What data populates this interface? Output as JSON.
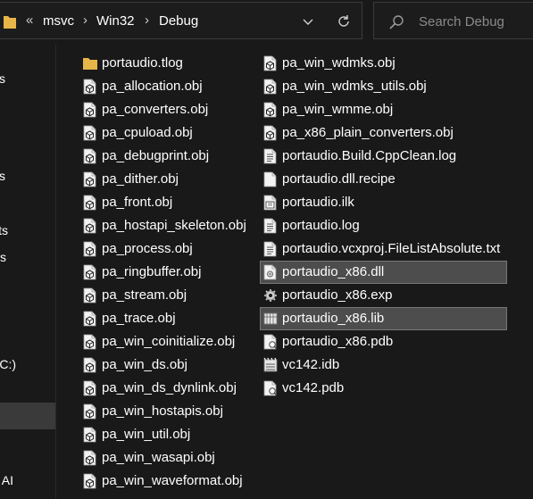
{
  "address_bar": {
    "overflow_label": "«",
    "breadcrumbs": [
      "msvc",
      "Win32",
      "Debug"
    ],
    "separator": "›",
    "dropdown_icon": "chevron-down-icon",
    "refresh_icon": "refresh-icon"
  },
  "search": {
    "placeholder": "Search Debug",
    "icon": "search-icon"
  },
  "nav_pane": {
    "items": [
      "s",
      "s",
      "ts",
      "s",
      "(C:)",
      "AI"
    ],
    "selected_index": 5
  },
  "colors": {
    "background": "#191919",
    "selection": "#4d4d4d",
    "folder": "#e8b548",
    "text": "#ffffff"
  },
  "files": {
    "column1": [
      {
        "name": "portaudio.tlog",
        "icon": "folder-icon"
      },
      {
        "name": "pa_allocation.obj",
        "icon": "obj-file-icon"
      },
      {
        "name": "pa_converters.obj",
        "icon": "obj-file-icon"
      },
      {
        "name": "pa_cpuload.obj",
        "icon": "obj-file-icon"
      },
      {
        "name": "pa_debugprint.obj",
        "icon": "obj-file-icon"
      },
      {
        "name": "pa_dither.obj",
        "icon": "obj-file-icon"
      },
      {
        "name": "pa_front.obj",
        "icon": "obj-file-icon"
      },
      {
        "name": "pa_hostapi_skeleton.obj",
        "icon": "obj-file-icon"
      },
      {
        "name": "pa_process.obj",
        "icon": "obj-file-icon"
      },
      {
        "name": "pa_ringbuffer.obj",
        "icon": "obj-file-icon"
      },
      {
        "name": "pa_stream.obj",
        "icon": "obj-file-icon"
      },
      {
        "name": "pa_trace.obj",
        "icon": "obj-file-icon"
      },
      {
        "name": "pa_win_coinitialize.obj",
        "icon": "obj-file-icon"
      },
      {
        "name": "pa_win_ds.obj",
        "icon": "obj-file-icon"
      },
      {
        "name": "pa_win_ds_dynlink.obj",
        "icon": "obj-file-icon"
      },
      {
        "name": "pa_win_hostapis.obj",
        "icon": "obj-file-icon"
      },
      {
        "name": "pa_win_util.obj",
        "icon": "obj-file-icon"
      },
      {
        "name": "pa_win_wasapi.obj",
        "icon": "obj-file-icon"
      },
      {
        "name": "pa_win_waveformat.obj",
        "icon": "obj-file-icon"
      }
    ],
    "column2": [
      {
        "name": "pa_win_wdmks.obj",
        "icon": "obj-file-icon"
      },
      {
        "name": "pa_win_wdmks_utils.obj",
        "icon": "obj-file-icon"
      },
      {
        "name": "pa_win_wmme.obj",
        "icon": "obj-file-icon"
      },
      {
        "name": "pa_x86_plain_converters.obj",
        "icon": "obj-file-icon"
      },
      {
        "name": "portaudio.Build.CppClean.log",
        "icon": "text-file-icon"
      },
      {
        "name": "portaudio.dll.recipe",
        "icon": "blank-file-icon"
      },
      {
        "name": "portaudio.ilk",
        "icon": "ilk-file-icon"
      },
      {
        "name": "portaudio.log",
        "icon": "text-file-icon"
      },
      {
        "name": "portaudio.vcxproj.FileListAbsolute.txt",
        "icon": "text-file-icon"
      },
      {
        "name": "portaudio_x86.dll",
        "icon": "dll-file-icon",
        "selected": true
      },
      {
        "name": "portaudio_x86.exp",
        "icon": "exp-file-icon"
      },
      {
        "name": "portaudio_x86.lib",
        "icon": "lib-file-icon",
        "selected": true
      },
      {
        "name": "portaudio_x86.pdb",
        "icon": "pdb-file-icon"
      },
      {
        "name": "vc142.idb",
        "icon": "idb-file-icon"
      },
      {
        "name": "vc142.pdb",
        "icon": "pdb-file-icon"
      }
    ]
  }
}
